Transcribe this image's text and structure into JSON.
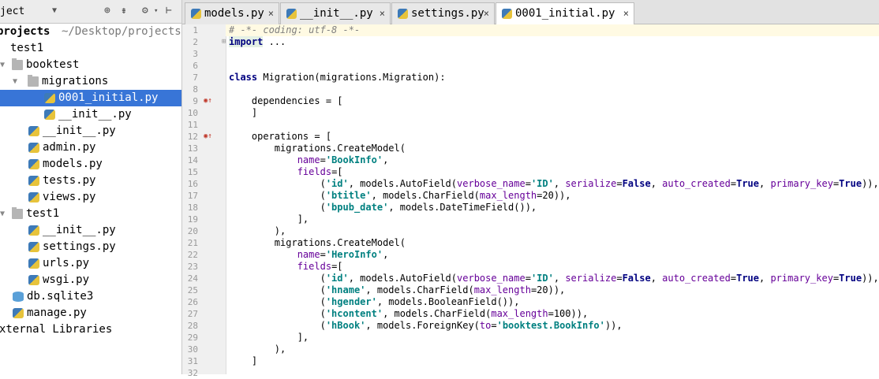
{
  "project_panel": {
    "title": "ject",
    "tree": [
      {
        "label": "projects",
        "extra": "~/Desktop/projects",
        "icon": "folder-icon"
      },
      {
        "label": "test1",
        "icon": "folder-icon"
      },
      {
        "label": "booktest",
        "icon": "folder-icon"
      },
      {
        "label": "migrations",
        "icon": "folder-icon"
      },
      {
        "label": "0001_initial.py",
        "icon": "python-file-icon",
        "selected": true
      },
      {
        "label": "__init__.py",
        "icon": "python-file-icon"
      },
      {
        "label": "__init__.py",
        "icon": "python-file-icon"
      },
      {
        "label": "admin.py",
        "icon": "python-file-icon"
      },
      {
        "label": "models.py",
        "icon": "python-file-icon"
      },
      {
        "label": "tests.py",
        "icon": "python-file-icon"
      },
      {
        "label": "views.py",
        "icon": "python-file-icon"
      },
      {
        "label": "test1",
        "icon": "folder-icon"
      },
      {
        "label": "__init__.py",
        "icon": "python-file-icon"
      },
      {
        "label": "settings.py",
        "icon": "python-file-icon"
      },
      {
        "label": "urls.py",
        "icon": "python-file-icon"
      },
      {
        "label": "wsgi.py",
        "icon": "python-file-icon"
      },
      {
        "label": "db.sqlite3",
        "icon": "database-icon"
      },
      {
        "label": "manage.py",
        "icon": "python-file-icon"
      },
      {
        "label": "xternal Libraries",
        "icon": "library-icon"
      }
    ]
  },
  "tabs": [
    {
      "label": "models.py",
      "active": false
    },
    {
      "label": "__init__.py",
      "active": false
    },
    {
      "label": "settings.py",
      "active": false
    },
    {
      "label": "0001_initial.py",
      "active": true
    }
  ],
  "tab_close_glyph": "×",
  "code_lines": [
    {
      "n": "1",
      "text": "# -*- coding: utf-8 -*-"
    },
    {
      "n": "2",
      "text": "import ..."
    },
    {
      "n": "3",
      "text": ""
    },
    {
      "n": "6",
      "text": ""
    },
    {
      "n": "7",
      "text": "class Migration(migrations.Migration):"
    },
    {
      "n": "8",
      "text": ""
    },
    {
      "n": "9",
      "text": "    dependencies = ["
    },
    {
      "n": "10",
      "text": "    ]"
    },
    {
      "n": "11",
      "text": ""
    },
    {
      "n": "12",
      "text": "    operations = ["
    },
    {
      "n": "13",
      "text": "        migrations.CreateModel("
    },
    {
      "n": "14",
      "text": "            name='BookInfo',"
    },
    {
      "n": "15",
      "text": "            fields=["
    },
    {
      "n": "16",
      "text": "                ('id', models.AutoField(verbose_name='ID', serialize=False, auto_created=True, primary_key=True)),"
    },
    {
      "n": "17",
      "text": "                ('btitle', models.CharField(max_length=20)),"
    },
    {
      "n": "18",
      "text": "                ('bpub_date', models.DateTimeField()),"
    },
    {
      "n": "19",
      "text": "            ],"
    },
    {
      "n": "20",
      "text": "        ),"
    },
    {
      "n": "21",
      "text": "        migrations.CreateModel("
    },
    {
      "n": "22",
      "text": "            name='HeroInfo',"
    },
    {
      "n": "23",
      "text": "            fields=["
    },
    {
      "n": "24",
      "text": "                ('id', models.AutoField(verbose_name='ID', serialize=False, auto_created=True, primary_key=True)),"
    },
    {
      "n": "25",
      "text": "                ('hname', models.CharField(max_length=20)),"
    },
    {
      "n": "26",
      "text": "                ('hgender', models.BooleanField()),"
    },
    {
      "n": "27",
      "text": "                ('hcontent', models.CharField(max_length=100)),"
    },
    {
      "n": "28",
      "text": "                ('hBook', models.ForeignKey(to='booktest.BookInfo')),"
    },
    {
      "n": "29",
      "text": "            ],"
    },
    {
      "n": "30",
      "text": "        ),"
    },
    {
      "n": "31",
      "text": "    ]"
    },
    {
      "n": "32",
      "text": ""
    }
  ],
  "colors": {
    "selection": "#3875d7",
    "keyword": "#000080",
    "string": "#008080",
    "kwarg": "#660099",
    "comment": "#808080"
  }
}
